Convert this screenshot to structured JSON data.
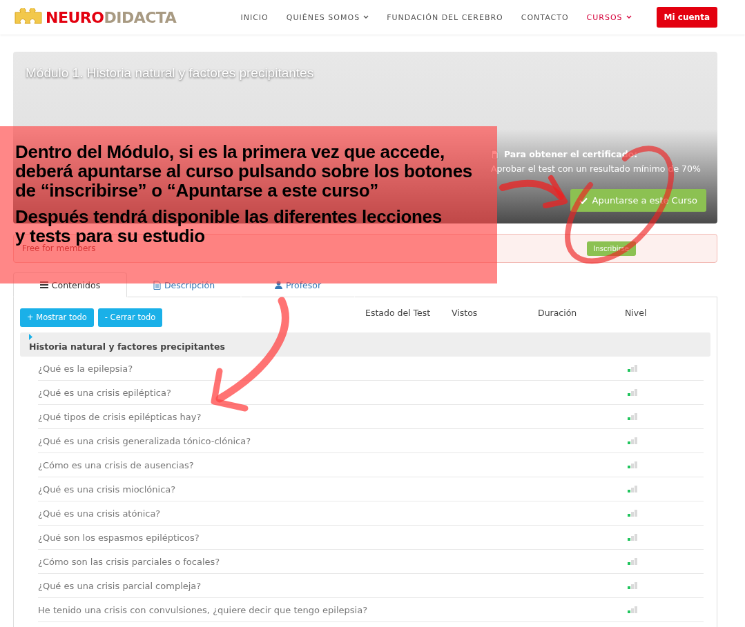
{
  "header": {
    "logo": {
      "part_1": "NEURO",
      "part_2": "DIDACTA"
    },
    "nav": [
      {
        "label": "INICIO",
        "selected": false,
        "dropdown": false
      },
      {
        "label": "QUIÉNES SOMOS",
        "selected": false,
        "dropdown": true
      },
      {
        "label": "FUNDACIÓN DEL CEREBRO",
        "selected": false,
        "dropdown": false
      },
      {
        "label": "CONTACTO",
        "selected": false,
        "dropdown": false
      },
      {
        "label": "CURSOS",
        "selected": true,
        "dropdown": true
      }
    ],
    "account_button": "Mi cuenta"
  },
  "hero": {
    "title": "Módulo 1. Historia natural y factores precipitantes",
    "certificate": {
      "title": "Para obtener el certificado:",
      "text": "Aprobar el test con un resultado mínimo de 70%"
    },
    "enroll_button": "Apuntarse a este Curso"
  },
  "alert": {
    "text": "Free for members",
    "button": "Inscribirse"
  },
  "tabs": [
    {
      "label": "Contenidos",
      "kind": "list",
      "selected": true
    },
    {
      "label": "Descripción",
      "kind": "document",
      "selected": false
    },
    {
      "label": "Profesor",
      "kind": "user",
      "selected": false
    }
  ],
  "toolbar": {
    "buttons": [
      "+ Mostrar todo",
      "- Cerrar todo"
    ]
  },
  "columns": [
    "Estado del Test",
    "Vistos",
    "Duración",
    "Nivel"
  ],
  "section": {
    "title": "Historia natural y factores precipitantes"
  },
  "lessons": [
    {
      "title": "¿Qué es la epilepsia?",
      "level": 0.33
    },
    {
      "title": "¿Qué es una crisis epiléptica?",
      "level": 0.33
    },
    {
      "title": "¿Qué tipos de crisis epilépticas hay?",
      "level": 0.33
    },
    {
      "title": "¿Qué es una crisis generalizada tónico-clónica?",
      "level": 0.33
    },
    {
      "title": "¿Cómo es una crisis de ausencias?",
      "level": 0.33
    },
    {
      "title": "¿Qué es una crisis mioclónica?",
      "level": 0.33
    },
    {
      "title": "¿Qué es una crisis atónica?",
      "level": 0.33
    },
    {
      "title": "¿Qué son los espasmos epilépticos?",
      "level": 0.33
    },
    {
      "title": "¿Cómo son las crisis parciales o focales?",
      "level": 0.33
    },
    {
      "title": "¿Qué es una crisis parcial compleja?",
      "level": 0.33
    },
    {
      "title": "He tenido una crisis con convulsiones, ¿quiere decir que tengo epilepsia?",
      "level": 0.33
    }
  ],
  "annotation": {
    "paragraphs": [
      [
        "Dentro del Módulo, si es la primera vez que accede,",
        "deberá apuntarse al curso pulsando sobre los botones",
        "de “inscribirse” o “Apuntarse a este curso”"
      ],
      [
        "Después tendrá disponible las diferentes lecciones",
        "y tests para su estudio"
      ]
    ]
  }
}
